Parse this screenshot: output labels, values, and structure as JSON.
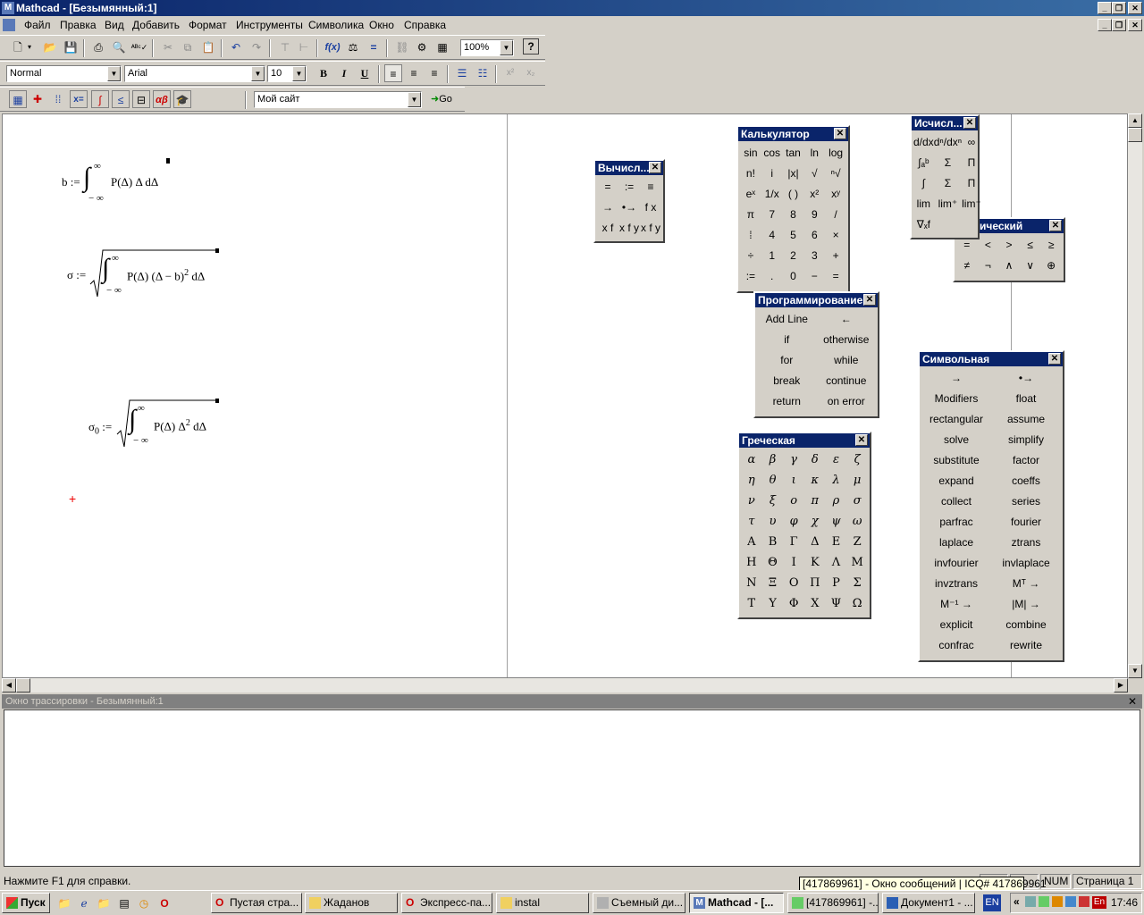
{
  "window": {
    "title": "Mathcad - [Безымянный:1]",
    "app_icon": "M"
  },
  "menu": [
    "Файл",
    "Правка",
    "Вид",
    "Добавить",
    "Формат",
    "Инструменты",
    "Символика",
    "Окно",
    "Справка"
  ],
  "toolbar": {
    "zoom": "100%"
  },
  "format_bar": {
    "style": "Normal",
    "font": "Arial",
    "size": "10",
    "bold": "B",
    "italic": "I",
    "underline": "U"
  },
  "resources_bar": {
    "site": "Мой сайт",
    "go": "Go"
  },
  "math_toolbar": {
    "xeq": "x=",
    "greek": "αβ"
  },
  "formulas": {
    "b": {
      "lhs": "b :=",
      "upper": "∞",
      "lower": "− ∞",
      "body": "P(Δ) Δ dΔ"
    },
    "sigma": {
      "lhs": "σ :=",
      "upper": "∞",
      "lower": "− ∞",
      "body": "P(Δ) (Δ − b)",
      "exp": "2",
      "tail": " dΔ"
    },
    "sigma0": {
      "lhs": "σ",
      "sub": "0",
      "assign": " :=",
      "upper": "∞",
      "lower": "− ∞",
      "body": "P(Δ) Δ",
      "exp": "2",
      "tail": " dΔ"
    }
  },
  "palettes": {
    "evaluation": {
      "title": "Вычисл...",
      "cells": [
        "=",
        ":=",
        "≡",
        "→",
        "•→",
        "f x",
        "x f",
        "x f y",
        "x f y"
      ]
    },
    "calculator": {
      "title": "Калькулятор",
      "cells": [
        "sin",
        "cos",
        "tan",
        "ln",
        "log",
        "n!",
        "i",
        "|x|",
        "√",
        "ⁿ√",
        "eˣ",
        "1/x",
        "( )",
        "x²",
        "xʸ",
        "π",
        "7",
        "8",
        "9",
        "/",
        "⁞",
        "4",
        "5",
        "6",
        "×",
        "÷",
        "1",
        "2",
        "3",
        "+",
        ":=",
        ".",
        "0",
        "−",
        "="
      ]
    },
    "calculus": {
      "title": "Исчисл...",
      "cells": [
        "d/dx",
        "dⁿ/dxⁿ",
        "∞",
        "∫ₐᵇ",
        "Σ",
        "Π",
        "∫",
        "Σ",
        "Π",
        "lim",
        "lim⁺",
        "lim⁻",
        "∇ₓf"
      ]
    },
    "boolean": {
      "title": "Логический",
      "title_visible": "ический",
      "cells": [
        "=",
        "<",
        ">",
        "≤",
        "≥",
        "≠",
        "¬",
        "∧",
        "∨",
        "⊕"
      ]
    },
    "programming": {
      "title": "Программирование",
      "cells": [
        "Add Line",
        "←",
        "if",
        "otherwise",
        "for",
        "while",
        "break",
        "continue",
        "return",
        "on error"
      ]
    },
    "greek": {
      "title": "Греческая",
      "cells": [
        "α",
        "β",
        "γ",
        "δ",
        "ε",
        "ζ",
        "η",
        "θ",
        "ι",
        "κ",
        "λ",
        "μ",
        "ν",
        "ξ",
        "ο",
        "π",
        "ρ",
        "σ",
        "τ",
        "υ",
        "φ",
        "χ",
        "ψ",
        "ω",
        "Α",
        "Β",
        "Γ",
        "Δ",
        "Ε",
        "Ζ",
        "Η",
        "Θ",
        "Ι",
        "Κ",
        "Λ",
        "Μ",
        "Ν",
        "Ξ",
        "Ο",
        "Π",
        "Ρ",
        "Σ",
        "Τ",
        "Υ",
        "Φ",
        "Χ",
        "Ψ",
        "Ω"
      ]
    },
    "symbolic": {
      "title": "Символьная",
      "cells": [
        "→",
        "•→",
        "Modifiers",
        "float",
        "rectangular",
        "assume",
        "solve",
        "simplify",
        "substitute",
        "factor",
        "expand",
        "coeffs",
        "collect",
        "series",
        "parfrac",
        "fourier",
        "laplace",
        "ztrans",
        "invfourier",
        "invlaplace",
        "invztrans",
        "Mᵀ →",
        "M⁻¹ →",
        "|M| →",
        "explicit",
        "combine",
        "confrac",
        "rewrite"
      ]
    }
  },
  "trace": {
    "title": "Окно трассировки - Безымянный:1"
  },
  "status": {
    "help": "Нажмите F1 для справки.",
    "num": "NUM",
    "page": "Страница 1"
  },
  "tooltip": "[417869961] - Окно сообщений | ICQ# 417869961",
  "taskbar": {
    "start": "Пуск",
    "buttons": [
      "Пустая стра...",
      "Жаданов",
      "Экспресс-па...",
      "instal",
      "Съемный ди...",
      "Mathcad - [...",
      "[417869961] -...",
      "Документ1 - ..."
    ],
    "lang": "EN",
    "clock": "17:46"
  }
}
